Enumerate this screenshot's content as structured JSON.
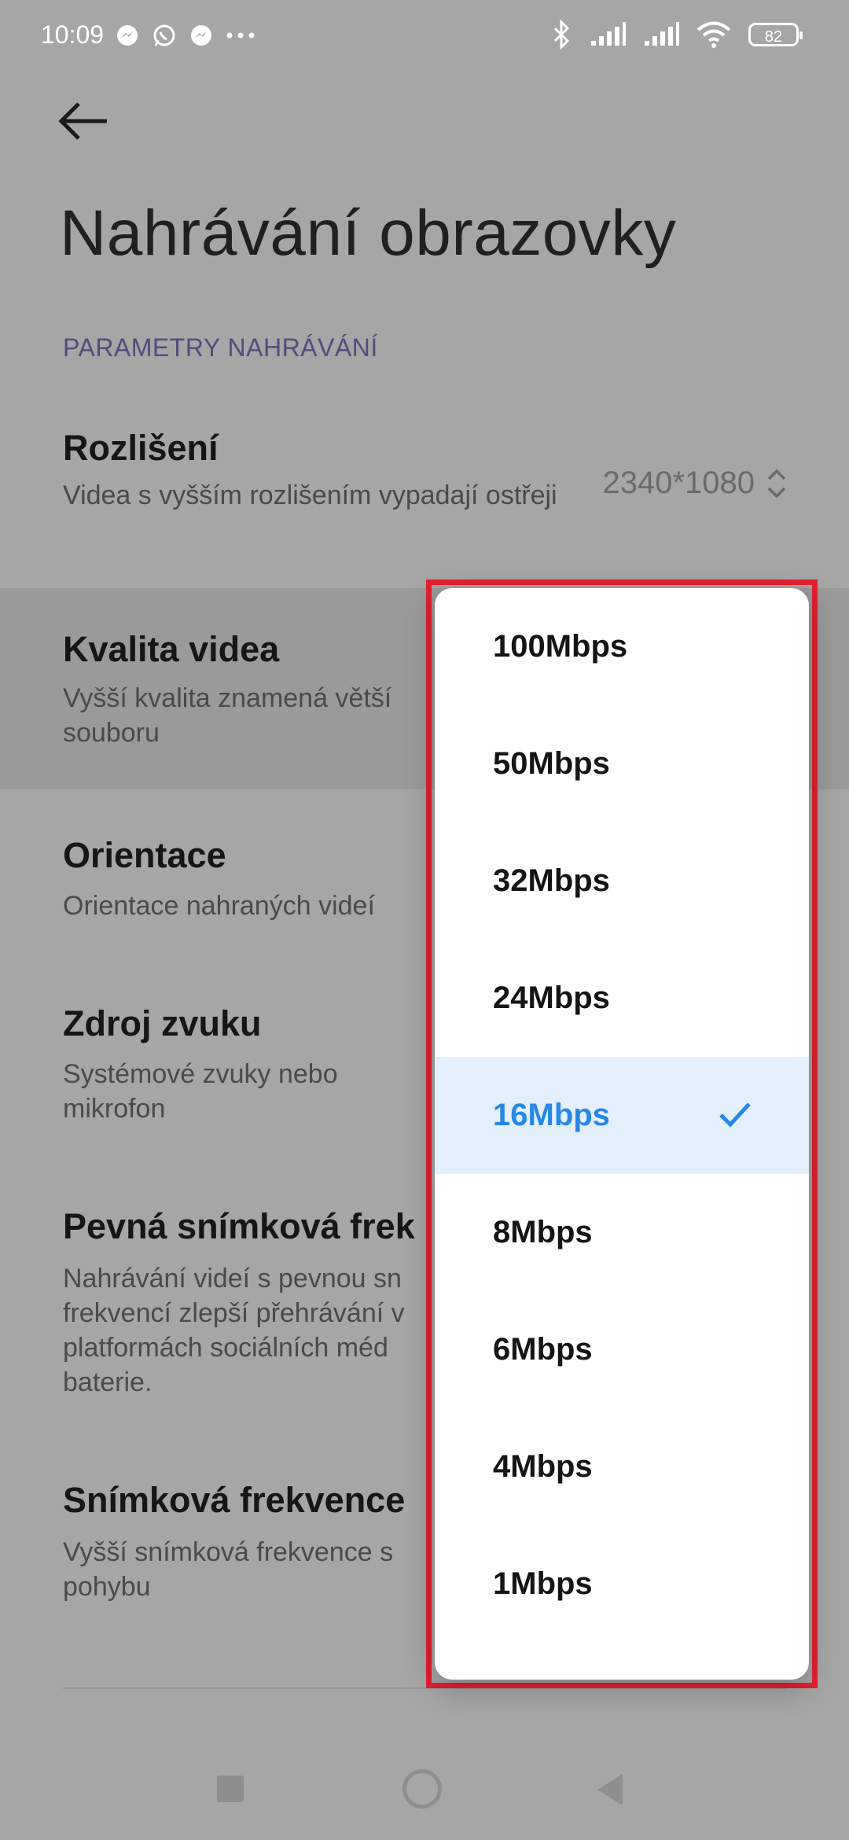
{
  "status_bar": {
    "time": "10:09",
    "left_icons": [
      "messenger-icon",
      "whatsapp-icon",
      "messenger-icon",
      "more-dots-icon"
    ],
    "right_icons": [
      "bluetooth-icon",
      "signal-icon",
      "signal-icon",
      "wifi-icon"
    ],
    "battery": "82"
  },
  "header": {
    "back_icon": "back-arrow-icon",
    "title": "Nahrávání obrazovky"
  },
  "section": {
    "header": "PARAMETRY NAHRÁVÁNÍ"
  },
  "settings": [
    {
      "title": "Rozlišení",
      "desc": "Videa s vyšším rozlišením vypadají ostřeji",
      "value": "2340*1080"
    },
    {
      "title": "Kvalita videa",
      "desc": "Vyšší kvalita znamená větší souboru"
    },
    {
      "title": "Orientace",
      "desc": "Orientace nahraných videí"
    },
    {
      "title": "Zdroj zvuku",
      "desc": "Systémové zvuky nebo mikrofon"
    },
    {
      "title": "Pevná snímková frek",
      "desc": "Nahrávání videí s pevnou sn frekvencí zlepší přehrávání v platformách sociálních méd baterie."
    },
    {
      "title": "Snímková frekvence",
      "desc": "Vyšší snímková frekvence s pohybu"
    }
  ],
  "dropdown": {
    "options": [
      {
        "label": "100Mbps",
        "selected": false
      },
      {
        "label": "50Mbps",
        "selected": false
      },
      {
        "label": "32Mbps",
        "selected": false
      },
      {
        "label": "24Mbps",
        "selected": false
      },
      {
        "label": "16Mbps",
        "selected": true
      },
      {
        "label": "8Mbps",
        "selected": false
      },
      {
        "label": "6Mbps",
        "selected": false
      },
      {
        "label": "4Mbps",
        "selected": false
      },
      {
        "label": "1Mbps",
        "selected": false
      }
    ],
    "accent_color": "#2787e6",
    "highlight_border_color": "#e5202e"
  },
  "nav_bar": {
    "icons": [
      "recents-square-icon",
      "home-circle-icon",
      "back-triangle-icon"
    ]
  }
}
